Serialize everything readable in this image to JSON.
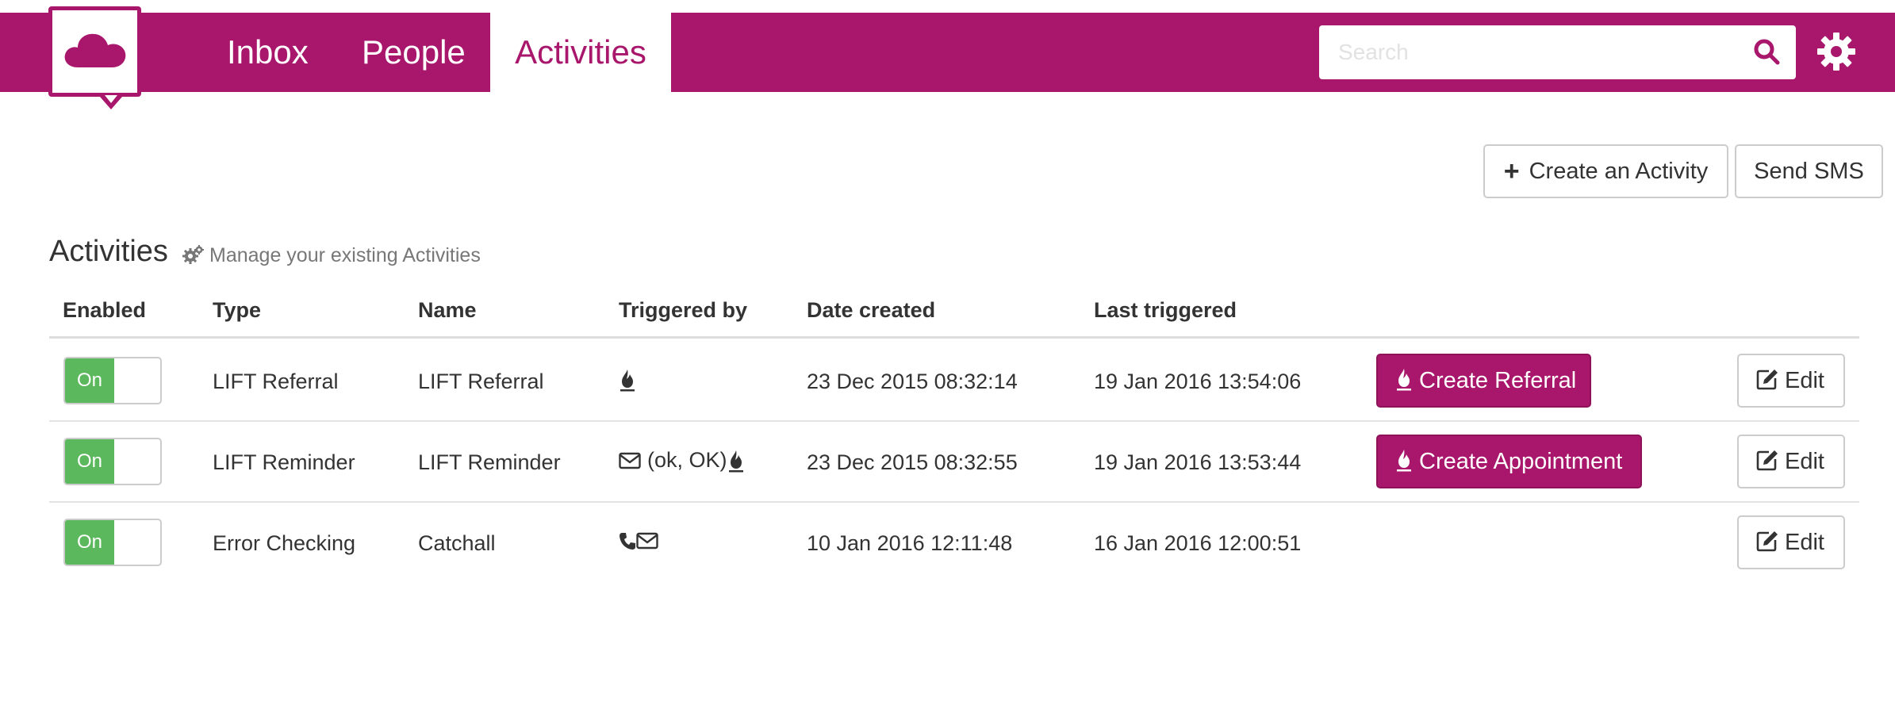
{
  "nav": {
    "items": [
      {
        "label": "Inbox",
        "active": false
      },
      {
        "label": "People",
        "active": false
      },
      {
        "label": "Activities",
        "active": true
      }
    ]
  },
  "search": {
    "placeholder": "Search",
    "value": ""
  },
  "icons": {
    "logo": "cloud-icon",
    "search": "search-icon",
    "settings": "gear-icon",
    "subtitle": "cogs-icon",
    "fire": "fire-icon",
    "mail": "envelope-icon",
    "phone": "phone-icon",
    "edit": "edit-icon",
    "plus": "plus-icon"
  },
  "toolbar": {
    "create_activity_label": "Create an Activity",
    "send_sms_label": "Send SMS"
  },
  "section": {
    "title": "Activities",
    "subtitle": "Manage your existing Activities"
  },
  "table": {
    "headers": [
      "Enabled",
      "Type",
      "Name",
      "Triggered by",
      "Date created",
      "Last triggered"
    ],
    "rows": [
      {
        "enabled": "On",
        "type": "LIFT Referral",
        "name": "LIFT Referral",
        "triggered_by_text": "",
        "date_created": "23 Dec 2015 08:32:14",
        "last_triggered": "19 Jan 2016 13:54:06",
        "action_label": "Create Referral",
        "edit_label": "Edit"
      },
      {
        "enabled": "On",
        "type": "LIFT Reminder",
        "name": "LIFT Reminder",
        "triggered_by_text": "(ok, OK)",
        "date_created": "23 Dec 2015 08:32:55",
        "last_triggered": "19 Jan 2016 13:53:44",
        "action_label": "Create Appointment",
        "edit_label": "Edit"
      },
      {
        "enabled": "On",
        "type": "Error Checking",
        "name": "Catchall",
        "triggered_by_text": "",
        "date_created": "10 Jan 2016 12:11:48",
        "last_triggered": "16 Jan 2016 12:00:51",
        "action_label": "",
        "edit_label": "Edit"
      }
    ]
  },
  "colors": {
    "brand": "#a8176b",
    "toggle_on": "#5cb85c",
    "border": "#cccccc"
  }
}
